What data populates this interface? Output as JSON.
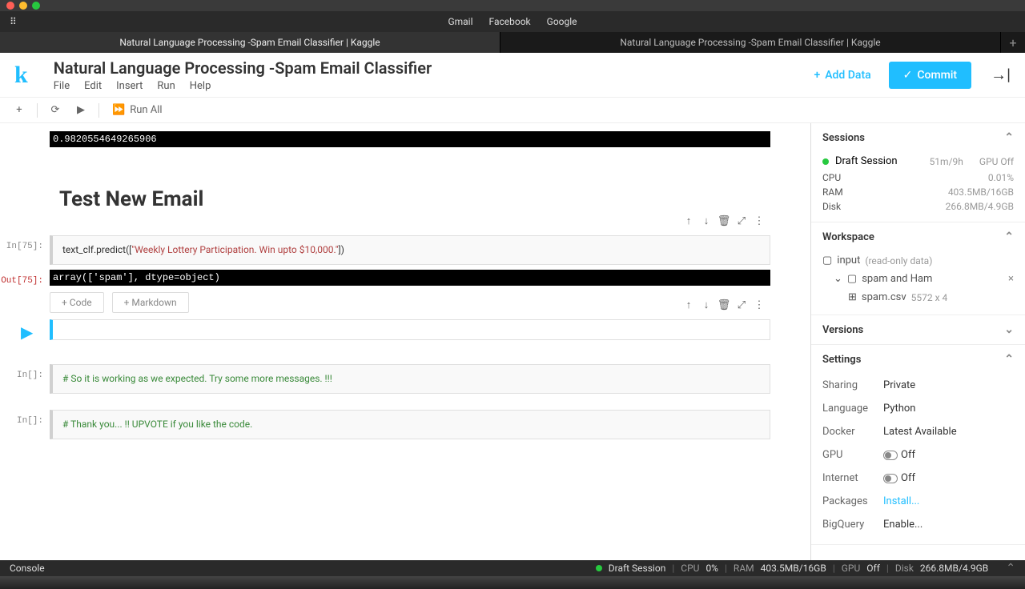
{
  "bookmarks": [
    "Gmail",
    "Facebook",
    "Google"
  ],
  "tabs": {
    "t1": "Natural Language Processing -Spam Email Classifier | Kaggle",
    "t2": "Natural Language Processing -Spam Email Classifier | Kaggle"
  },
  "header": {
    "title": "Natural Language Processing -Spam Email Classifier",
    "menu": {
      "file": "File",
      "edit": "Edit",
      "insert": "Insert",
      "run": "Run",
      "help": "Help"
    },
    "add_data": "Add Data",
    "commit": "Commit"
  },
  "toolbar": {
    "run_all": "Run All"
  },
  "notebook": {
    "accuracy": "0.9820554649265906",
    "heading": "Test New Email",
    "cell_in75_prompt": "In[75]:",
    "cell_in75_code_pre": "text_clf.predict([",
    "cell_in75_code_str": "\"Weekly Lottery Participation. Win upto $10,000.\"",
    "cell_in75_code_post": "])",
    "cell_out75_prompt": "Out[75]:",
    "cell_out75_output": "array(['spam'], dtype=object)",
    "add_code": "+ Code",
    "add_markdown": "+ Markdown",
    "empty_prompt": "In[]:",
    "comment1": "# So it is working as we expected. Try some more messages. !!!",
    "comment2": "# Thank you... !! UPVOTE if you like the code."
  },
  "sidebar": {
    "sessions": {
      "title": "Sessions",
      "draft": "Draft Session",
      "time": "51m/9h",
      "gpu": "GPU Off",
      "cpu_label": "CPU",
      "cpu_val": "0.01%",
      "ram_label": "RAM",
      "ram_val": "403.5MB/16GB",
      "disk_label": "Disk",
      "disk_val": "266.8MB/4.9GB"
    },
    "workspace": {
      "title": "Workspace",
      "input": "input",
      "input_meta": "(read-only data)",
      "folder": "spam and Ham",
      "file": "spam.csv",
      "file_meta": "5572 x 4"
    },
    "versions": {
      "title": "Versions"
    },
    "settings": {
      "title": "Settings",
      "sharing_l": "Sharing",
      "sharing_v": "Private",
      "language_l": "Language",
      "language_v": "Python",
      "docker_l": "Docker",
      "docker_v": "Latest Available",
      "gpu_l": "GPU",
      "gpu_v": "Off",
      "internet_l": "Internet",
      "internet_v": "Off",
      "packages_l": "Packages",
      "packages_v": "Install...",
      "bigquery_l": "BigQuery",
      "bigquery_v": "Enable..."
    }
  },
  "console": {
    "label": "Console",
    "session": "Draft Session",
    "cpu_l": "CPU",
    "cpu_v": "0%",
    "ram_l": "RAM",
    "ram_v": "403.5MB/16GB",
    "gpu_l": "GPU",
    "gpu_v": "Off",
    "disk_l": "Disk",
    "disk_v": "266.8MB/4.9GB"
  }
}
